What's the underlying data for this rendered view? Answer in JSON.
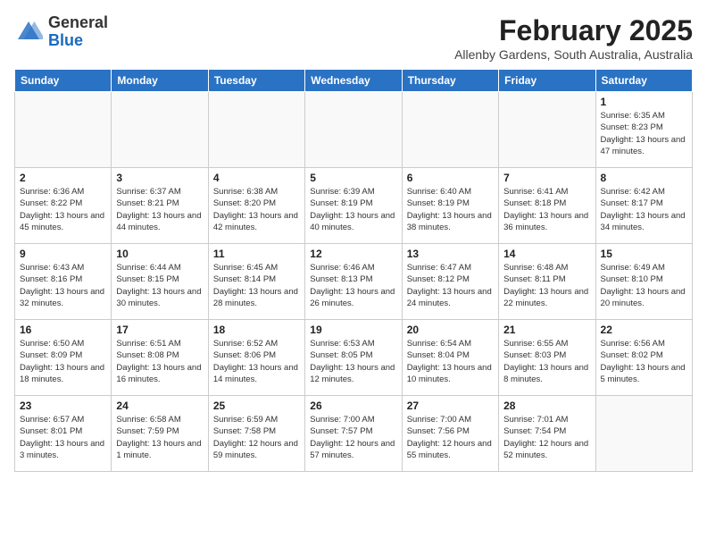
{
  "header": {
    "logo": {
      "general": "General",
      "blue": "Blue"
    },
    "month_year": "February 2025",
    "location": "Allenby Gardens, South Australia, Australia"
  },
  "days_of_week": [
    "Sunday",
    "Monday",
    "Tuesday",
    "Wednesday",
    "Thursday",
    "Friday",
    "Saturday"
  ],
  "weeks": [
    [
      {
        "day": "",
        "info": ""
      },
      {
        "day": "",
        "info": ""
      },
      {
        "day": "",
        "info": ""
      },
      {
        "day": "",
        "info": ""
      },
      {
        "day": "",
        "info": ""
      },
      {
        "day": "",
        "info": ""
      },
      {
        "day": "1",
        "info": "Sunrise: 6:35 AM\nSunset: 8:23 PM\nDaylight: 13 hours and 47 minutes."
      }
    ],
    [
      {
        "day": "2",
        "info": "Sunrise: 6:36 AM\nSunset: 8:22 PM\nDaylight: 13 hours and 45 minutes."
      },
      {
        "day": "3",
        "info": "Sunrise: 6:37 AM\nSunset: 8:21 PM\nDaylight: 13 hours and 44 minutes."
      },
      {
        "day": "4",
        "info": "Sunrise: 6:38 AM\nSunset: 8:20 PM\nDaylight: 13 hours and 42 minutes."
      },
      {
        "day": "5",
        "info": "Sunrise: 6:39 AM\nSunset: 8:19 PM\nDaylight: 13 hours and 40 minutes."
      },
      {
        "day": "6",
        "info": "Sunrise: 6:40 AM\nSunset: 8:19 PM\nDaylight: 13 hours and 38 minutes."
      },
      {
        "day": "7",
        "info": "Sunrise: 6:41 AM\nSunset: 8:18 PM\nDaylight: 13 hours and 36 minutes."
      },
      {
        "day": "8",
        "info": "Sunrise: 6:42 AM\nSunset: 8:17 PM\nDaylight: 13 hours and 34 minutes."
      }
    ],
    [
      {
        "day": "9",
        "info": "Sunrise: 6:43 AM\nSunset: 8:16 PM\nDaylight: 13 hours and 32 minutes."
      },
      {
        "day": "10",
        "info": "Sunrise: 6:44 AM\nSunset: 8:15 PM\nDaylight: 13 hours and 30 minutes."
      },
      {
        "day": "11",
        "info": "Sunrise: 6:45 AM\nSunset: 8:14 PM\nDaylight: 13 hours and 28 minutes."
      },
      {
        "day": "12",
        "info": "Sunrise: 6:46 AM\nSunset: 8:13 PM\nDaylight: 13 hours and 26 minutes."
      },
      {
        "day": "13",
        "info": "Sunrise: 6:47 AM\nSunset: 8:12 PM\nDaylight: 13 hours and 24 minutes."
      },
      {
        "day": "14",
        "info": "Sunrise: 6:48 AM\nSunset: 8:11 PM\nDaylight: 13 hours and 22 minutes."
      },
      {
        "day": "15",
        "info": "Sunrise: 6:49 AM\nSunset: 8:10 PM\nDaylight: 13 hours and 20 minutes."
      }
    ],
    [
      {
        "day": "16",
        "info": "Sunrise: 6:50 AM\nSunset: 8:09 PM\nDaylight: 13 hours and 18 minutes."
      },
      {
        "day": "17",
        "info": "Sunrise: 6:51 AM\nSunset: 8:08 PM\nDaylight: 13 hours and 16 minutes."
      },
      {
        "day": "18",
        "info": "Sunrise: 6:52 AM\nSunset: 8:06 PM\nDaylight: 13 hours and 14 minutes."
      },
      {
        "day": "19",
        "info": "Sunrise: 6:53 AM\nSunset: 8:05 PM\nDaylight: 13 hours and 12 minutes."
      },
      {
        "day": "20",
        "info": "Sunrise: 6:54 AM\nSunset: 8:04 PM\nDaylight: 13 hours and 10 minutes."
      },
      {
        "day": "21",
        "info": "Sunrise: 6:55 AM\nSunset: 8:03 PM\nDaylight: 13 hours and 8 minutes."
      },
      {
        "day": "22",
        "info": "Sunrise: 6:56 AM\nSunset: 8:02 PM\nDaylight: 13 hours and 5 minutes."
      }
    ],
    [
      {
        "day": "23",
        "info": "Sunrise: 6:57 AM\nSunset: 8:01 PM\nDaylight: 13 hours and 3 minutes."
      },
      {
        "day": "24",
        "info": "Sunrise: 6:58 AM\nSunset: 7:59 PM\nDaylight: 13 hours and 1 minute."
      },
      {
        "day": "25",
        "info": "Sunrise: 6:59 AM\nSunset: 7:58 PM\nDaylight: 12 hours and 59 minutes."
      },
      {
        "day": "26",
        "info": "Sunrise: 7:00 AM\nSunset: 7:57 PM\nDaylight: 12 hours and 57 minutes."
      },
      {
        "day": "27",
        "info": "Sunrise: 7:00 AM\nSunset: 7:56 PM\nDaylight: 12 hours and 55 minutes."
      },
      {
        "day": "28",
        "info": "Sunrise: 7:01 AM\nSunset: 7:54 PM\nDaylight: 12 hours and 52 minutes."
      },
      {
        "day": "",
        "info": ""
      }
    ]
  ]
}
